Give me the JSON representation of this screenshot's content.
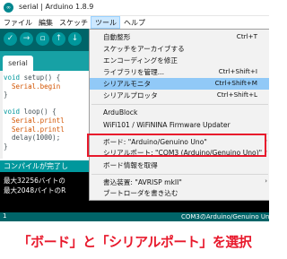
{
  "window": {
    "title": "serial | Arduino 1.8.9"
  },
  "menubar": {
    "items": [
      "ファイル",
      "編集",
      "スケッチ",
      "ツール",
      "ヘルプ"
    ]
  },
  "tab": {
    "label": "serial"
  },
  "code": {
    "lines": [
      [
        "void",
        " setup() {"
      ],
      [
        "  ",
        "Serial.begin"
      ],
      [
        "}",
        ""
      ],
      [
        "",
        ""
      ],
      [
        "void",
        " loop() {"
      ],
      [
        "  ",
        "Serial.printl"
      ],
      [
        "  ",
        "Serial.printl"
      ],
      [
        "  ",
        "delay(1000);"
      ],
      [
        "}",
        ""
      ]
    ]
  },
  "status": {
    "text": "コンパイルが完了し"
  },
  "console": {
    "lines": [
      "最大32256バイトの",
      "最大2048バイトのR"
    ]
  },
  "bottom": {
    "line_number": "1",
    "board_port": "COM3のArduino/Genuino Uno"
  },
  "dropdown": {
    "items": [
      {
        "label": "自動整形",
        "shortcut": "Ctrl+T"
      },
      {
        "label": "スケッチをアーカイブする",
        "shortcut": ""
      },
      {
        "label": "エンコーディングを修正",
        "shortcut": ""
      },
      {
        "label": "ライブラリを管理...",
        "shortcut": "Ctrl+Shift+I"
      },
      {
        "label": "シリアルモニタ",
        "shortcut": "Ctrl+Shift+M"
      },
      {
        "label": "シリアルプロッタ",
        "shortcut": "Ctrl+Shift+L"
      },
      {
        "label": "ArduBlock",
        "shortcut": ""
      },
      {
        "label": "WiFi101 / WiFiNINA Firmware Updater",
        "shortcut": ""
      },
      {
        "label": "ボード: \"Arduino/Genuino Uno\"",
        "shortcut": ""
      },
      {
        "label": "シリアルポート: \"COM3 (Arduino/Genuino Uno)\"",
        "shortcut": ""
      },
      {
        "label": "ボード情報を取得",
        "shortcut": ""
      },
      {
        "label": "書込装置: \"AVRISP mkII\"",
        "shortcut": ""
      },
      {
        "label": "ブートローダを書き込む",
        "shortcut": ""
      }
    ]
  },
  "caption": {
    "text": "「ボード」と「シリアルポート」を選択"
  },
  "colors": {
    "teal_dark": "#006468",
    "teal": "#00979c",
    "highlight": "#91c9f7",
    "annotation_red": "#e8192c"
  }
}
